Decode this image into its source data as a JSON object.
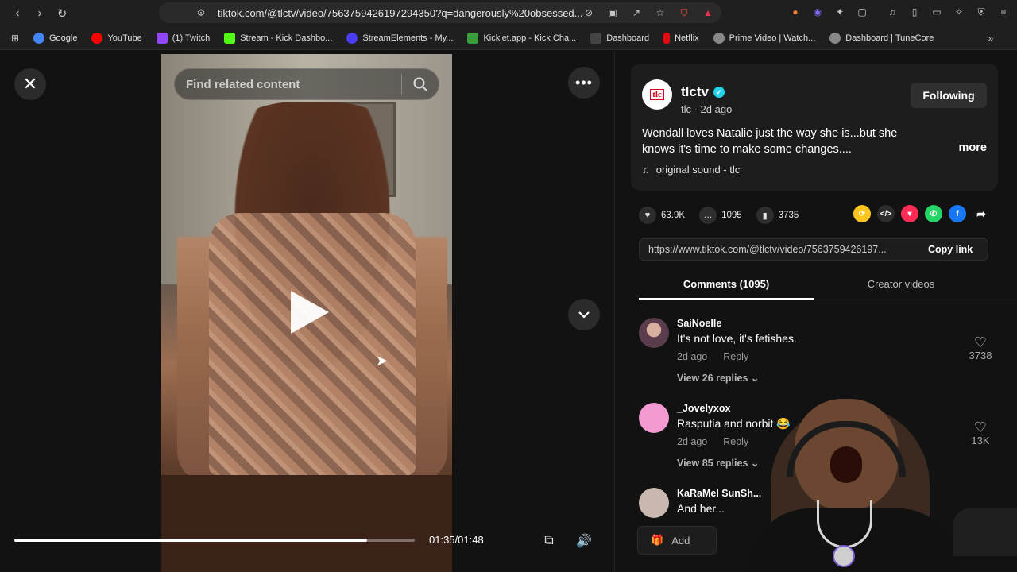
{
  "browser": {
    "url": "tiktok.com/@tlctv/video/7563759426197294350?q=dangerously%20obsessed...",
    "bookmarks": [
      {
        "label": "Google",
        "color": "#4285f4"
      },
      {
        "label": "YouTube",
        "color": "#ff0000"
      },
      {
        "label": "(1) Twitch",
        "color": "#9146ff"
      },
      {
        "label": "Stream - Kick Dashbo...",
        "color": "#53fc18"
      },
      {
        "label": "StreamElements - My...",
        "color": "#4b3cf5"
      },
      {
        "label": "Kicklet.app - Kick Cha...",
        "color": "#3c9d3c"
      },
      {
        "label": "Dashboard",
        "color": "#222222"
      },
      {
        "label": "Netflix",
        "color": "#e50914"
      },
      {
        "label": "Prime Video | Watch...",
        "color": "#888888"
      },
      {
        "label": "Dashboard | TuneCore",
        "color": "#888888"
      }
    ]
  },
  "video": {
    "search_placeholder": "Find related content",
    "time": "01:35/01:48",
    "progress": 0.88
  },
  "post": {
    "username": "tlctv",
    "avatar_text": "tlc",
    "subline": "tlc · 2d ago",
    "follow_label": "Following",
    "description": "Wendall loves Natalie just the way she is...but she knows it's time to make some changes....",
    "more_label": "more",
    "sound": "original sound - tlc",
    "likes": "63.9K",
    "comments": "1095",
    "saves": "3735",
    "link": "https://www.tiktok.com/@tlctv/video/7563759426197...",
    "copy_label": "Copy link"
  },
  "tabs": {
    "comments": "Comments (1095)",
    "creator": "Creator videos"
  },
  "comments": [
    {
      "name": "SaiNoelle",
      "text": "It's not love, it's fetishes.",
      "time": "2d ago",
      "reply": "Reply",
      "replies": "View 26 replies ⌄",
      "likes": "3738"
    },
    {
      "name": "_Jovelyxox",
      "text": "Rasputia and norbit 😂",
      "time": "2d ago",
      "reply": "Reply",
      "replies": "View 85 replies ⌄",
      "likes": "13K"
    },
    {
      "name": "KaRaMel SunSh...",
      "text": "And her..."
    }
  ],
  "add_comment": "Add"
}
